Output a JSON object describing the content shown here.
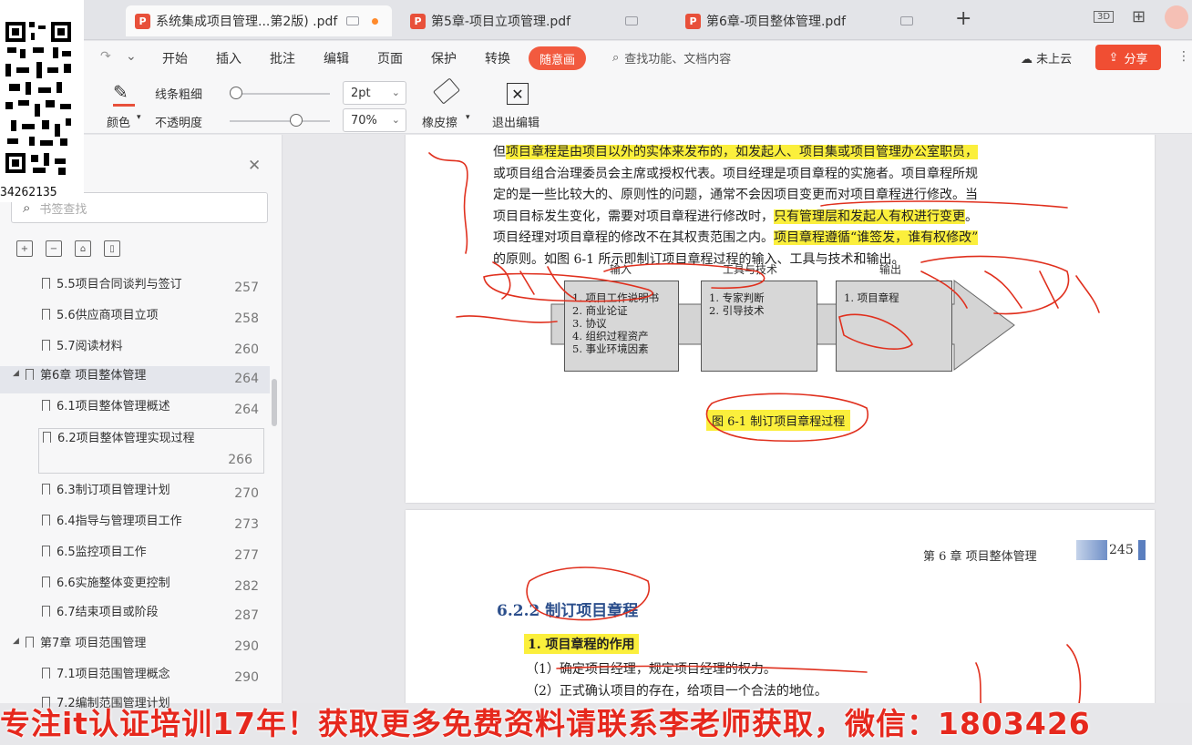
{
  "tabs": [
    {
      "label": "系统集成项目管理...第2版) .pdf",
      "active": true
    },
    {
      "label": "第5章-项目立项管理.pdf",
      "active": false
    },
    {
      "label": "第6章-项目整体管理.pdf",
      "active": false
    }
  ],
  "qr_number": "34262135",
  "menu": {
    "items": [
      "开始",
      "插入",
      "批注",
      "编辑",
      "页面",
      "保护",
      "转换"
    ],
    "active_pill": "随意画",
    "search_placeholder": "查找功能、文档内容",
    "cloud_label": "未上云",
    "share_label": "分享"
  },
  "ribbon": {
    "color_label": "颜色",
    "line_width_label": "线条粗细",
    "line_width_value": "2pt",
    "opacity_label": "不透明度",
    "opacity_value": "70%",
    "eraser_label": "橡皮擦",
    "exit_label": "退出编辑"
  },
  "sidebar": {
    "search_placeholder": "书签查找",
    "items": [
      {
        "label": "5.5项目合同谈判与签订",
        "page": "257",
        "level": 2
      },
      {
        "label": "5.6供应商项目立项",
        "page": "258",
        "level": 2
      },
      {
        "label": "5.7阅读材料",
        "page": "260",
        "level": 2
      },
      {
        "label": "第6章 项目整体管理",
        "page": "264",
        "level": 1
      },
      {
        "label": "6.1项目整体管理概述",
        "page": "264",
        "level": 2
      },
      {
        "label": "6.2项目整体管理实现过程",
        "page": "266",
        "level": 2
      },
      {
        "label": "6.3制订项目管理计划",
        "page": "270",
        "level": 2
      },
      {
        "label": "6.4指导与管理项目工作",
        "page": "273",
        "level": 2
      },
      {
        "label": "6.5监控项目工作",
        "page": "277",
        "level": 2
      },
      {
        "label": "6.6实施整体变更控制",
        "page": "282",
        "level": 2
      },
      {
        "label": "6.7结束项目或阶段",
        "page": "287",
        "level": 2
      },
      {
        "label": "第7章 项目范围管理",
        "page": "290",
        "level": 1
      },
      {
        "label": "7.1项目范围管理概念",
        "page": "290",
        "level": 2
      },
      {
        "label": "7.2编制范围管理计划",
        "page": "",
        "level": 2
      }
    ]
  },
  "page1": {
    "lines": [
      {
        "pre": "但",
        "hl": "项目章程是由项目以外的实体来发布的，如发起人、项目集或项目管理办公室职员，",
        "post": ""
      },
      {
        "pre": "或项目组合治理委员会主席或授权代表。项目经理是项目章程的实施者。项目章程所规",
        "hl": "",
        "post": ""
      },
      {
        "pre": "定的是一些比较大的、原则性的问题，通常不会因项目变更而对项目章程进行修改。当",
        "hl": "",
        "post": ""
      },
      {
        "pre": "项目目标发生变化，需要对项目章程进行修改时，",
        "hl": "只有管理层和发起人有权进行变更",
        "post": "。"
      },
      {
        "pre": "项目经理对项目章程的修改不在其权责范围之内。",
        "hl": "项目章程遵循“谁签发，谁有权修改”",
        "post": ""
      },
      {
        "pre": "的原则。如图 6-1 所示即制订项目章程过程的输入、工具与技术和输出。",
        "hl": "",
        "post": ""
      }
    ],
    "flow": {
      "input_head": "输入",
      "tools_head": "工具与技术",
      "output_head": "输出",
      "inputs": [
        "1. 项目工作说明书",
        "2. 商业论证",
        "3. 协议",
        "4. 组织过程资产",
        "5. 事业环境因素"
      ],
      "tools": [
        "1. 专家判断",
        "2. 引导技术"
      ],
      "outputs": [
        "1. 项目章程"
      ]
    },
    "caption": "图 6-1  制订项目章程过程"
  },
  "page2": {
    "header_chapter": "第 6 章   项目整体管理",
    "page_number": "245",
    "section": "6.2.2    制订项目章程",
    "subsection": "1. 项目章程的作用",
    "list": [
      "（1）确定项目经理，规定项目经理的权力。",
      "（2）正式确认项目的存在，给项目一个合法的地位。"
    ]
  },
  "banner": "专注it认证培训17年！获取更多免费资料请联系李老师获取，微信：1803426"
}
